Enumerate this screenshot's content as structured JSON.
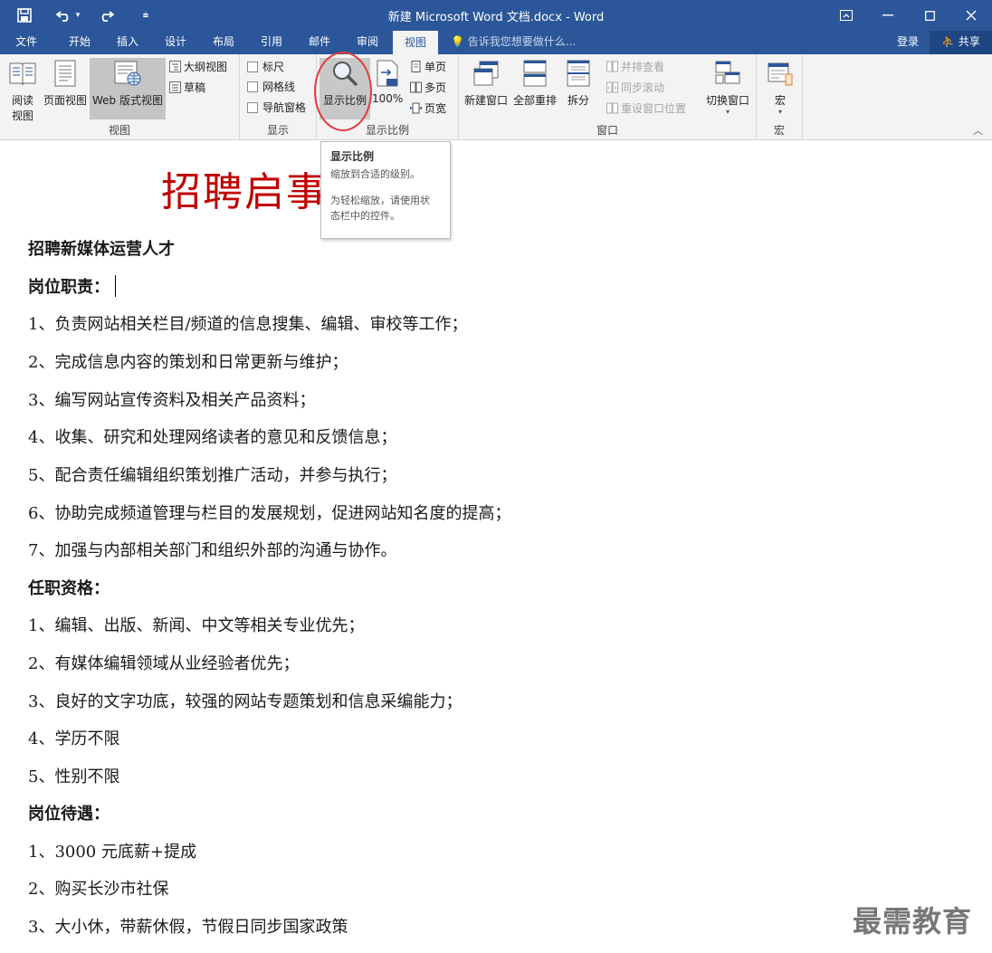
{
  "window": {
    "title": "新建 Microsoft Word 文档.docx - Word",
    "icons": [
      "save-icon",
      "undo-icon",
      "redo-icon",
      "customize-qat-icon",
      "ribbon-display-icon",
      "minimize-icon",
      "maximize-icon",
      "close-icon"
    ]
  },
  "tabs": [
    "文件",
    "开始",
    "插入",
    "设计",
    "布局",
    "引用",
    "邮件",
    "审阅",
    "视图"
  ],
  "active_tab": "视图",
  "tell_me": "告诉我您想要做什么...",
  "account": {
    "signin": "登录",
    "share": "共享"
  },
  "ribbon": {
    "views": {
      "label": "视图",
      "read_mode": [
        "阅读",
        "视图"
      ],
      "print_layout": "页面视图",
      "web_layout": "Web 版式视图",
      "outline": "大纲视图",
      "draft": "草稿"
    },
    "show": {
      "label": "显示",
      "ruler": "标尺",
      "gridlines": "网格线",
      "nav_pane": "导航窗格"
    },
    "zoom": {
      "label": "显示比例",
      "zoom": "显示比例",
      "hundred": "100%",
      "one_page": "单页",
      "multi_page": "多页",
      "page_width": "页宽"
    },
    "window": {
      "label": "窗口",
      "new_window": "新建窗口",
      "arrange_all": "全部重排",
      "split": "拆分",
      "side_by_side": "并排查看",
      "sync_scroll": "同步滚动",
      "reset_position": "重设窗口位置",
      "switch_windows": "切换窗口"
    },
    "macros": {
      "label": "宏",
      "macros": "宏"
    }
  },
  "tooltip": {
    "title": "显示比例",
    "line1": "缩放到合适的级别。",
    "line2": "为轻松缩放，请使用状",
    "line3": "态栏中的控件。"
  },
  "document": {
    "heading": "招聘启事",
    "subtitle": "招聘新媒体运营人才",
    "duties_title": "岗位职责：",
    "duties": [
      "1、负责网站相关栏目/频道的信息搜集、编辑、审校等工作；",
      "2、完成信息内容的策划和日常更新与维护；",
      "3、编写网站宣传资料及相关产品资料；",
      "4、收集、研究和处理网络读者的意见和反馈信息；",
      "5、配合责任编辑组织策划推广活动，并参与执行；",
      "6、协助完成频道管理与栏目的发展规划，促进网站知名度的提高；",
      "7、加强与内部相关部门和组织外部的沟通与协作。"
    ],
    "qual_title": "任职资格：",
    "quals": [
      "1、编辑、出版、新闻、中文等相关专业优先；",
      "2、有媒体编辑领域从业经验者优先；",
      "3、良好的文字功底，较强的网站专题策划和信息采编能力；",
      "4、学历不限",
      "5、性别不限"
    ],
    "benefit_title": "岗位待遇：",
    "benefits": [
      "1、3000 元底薪+提成",
      "2、购买长沙市社保",
      "3、大小休，带薪休假，节假日同步国家政策"
    ]
  },
  "watermark": "最需教育",
  "colors": {
    "accent": "#2b579a",
    "heading_red": "#c00000",
    "highlight_circle": "#e23b3b"
  }
}
